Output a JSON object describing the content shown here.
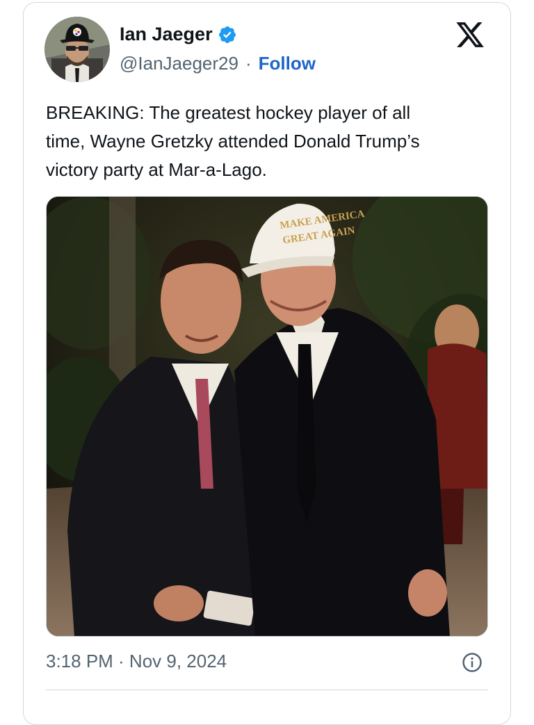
{
  "author": {
    "name": "Ian Jaeger",
    "handle": "@IanJaeger29",
    "separator": "·",
    "follow_label": "Follow",
    "avatar_icon": "avatar-image",
    "verified_icon": "verified-badge-icon"
  },
  "platform_icon": "x-logo-icon",
  "tweet": {
    "text": "BREAKING: The greatest hockey player of all\ntime, Wayne Gretzky attended Donald Trump’s\nvictory party at Mar-a-Lago."
  },
  "photo": {
    "hat_line1": "MAKE AMERICA",
    "hat_line2": "GREAT AGAIN"
  },
  "footer": {
    "timestamp": "3:18 PM · Nov 9, 2024",
    "info_icon": "info-icon"
  },
  "colors": {
    "follow": "#1d66c9",
    "verified": "#1d9bf0",
    "secondary_text": "#536471",
    "border": "#cfd9de"
  }
}
